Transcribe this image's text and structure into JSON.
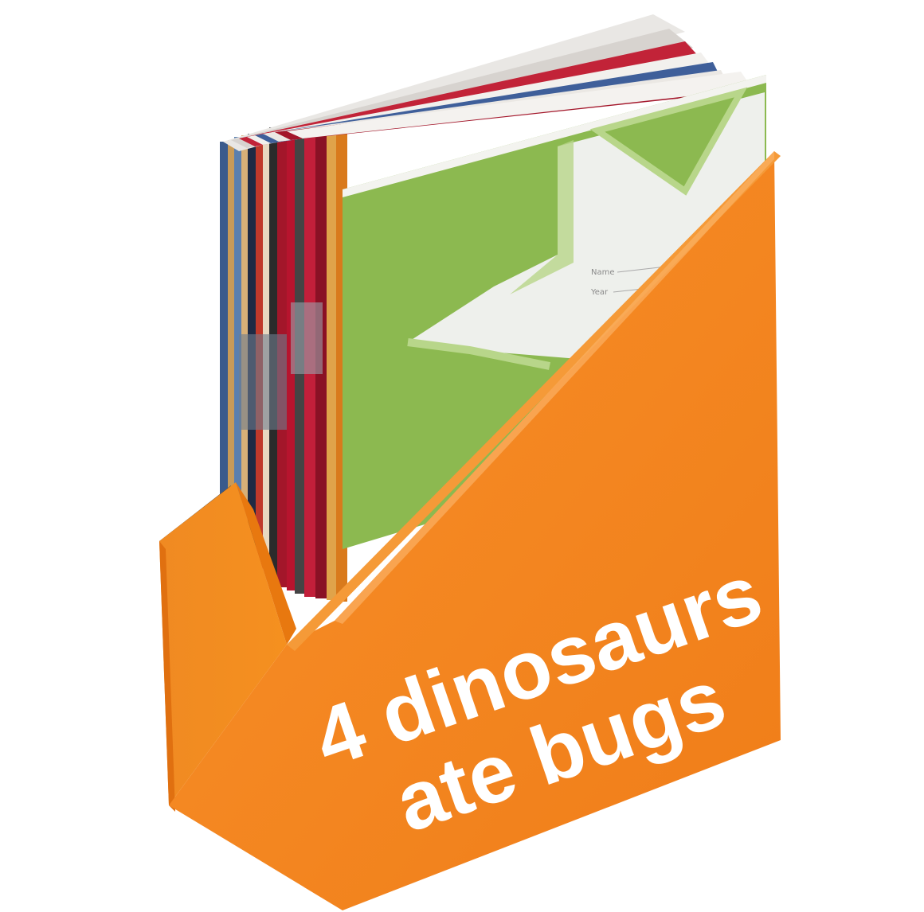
{
  "overlay": {
    "line1": "4 dinosaurs",
    "line2": "ate bugs",
    "color": "#ffffff"
  },
  "notebook_labels": {
    "name": "Name",
    "year": "Year"
  },
  "colors": {
    "box_front": "#f5851f",
    "box_shade": "#e27312",
    "box_inner": "#d9690f",
    "notebook_green": "#8cb950",
    "notebook_green_light": "#b8d68a",
    "notebook_white": "#eef0ec"
  }
}
